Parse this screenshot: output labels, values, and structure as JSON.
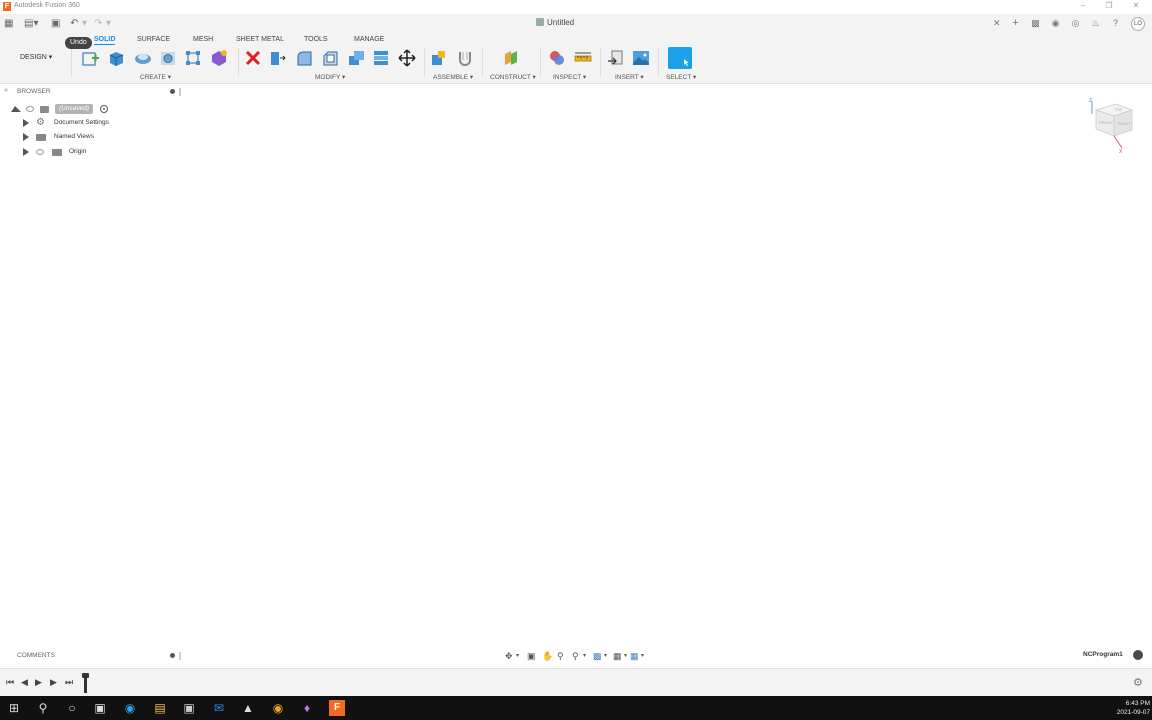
{
  "app": {
    "title": "Autodesk Fusion 360",
    "icon_letter": "F",
    "document_tab": "Untitled",
    "user_initials": "LO"
  },
  "tooltip": {
    "text": "Undo"
  },
  "tabs": [
    {
      "label": "SOLID",
      "active": true
    },
    {
      "label": "SURFACE"
    },
    {
      "label": "MESH"
    },
    {
      "label": "SHEET METAL"
    },
    {
      "label": "TOOLS"
    },
    {
      "label": "MANAGE"
    }
  ],
  "workspace_label": "DESIGN",
  "groups": {
    "create": "CREATE",
    "modify": "MODIFY",
    "assemble": "ASSEMBLE",
    "construct": "CONSTRUCT",
    "inspect": "INSPECT",
    "insert": "INSERT",
    "select": "SELECT"
  },
  "browser": {
    "title": "BROWSER",
    "root": "(Unsaved)",
    "items": [
      {
        "label": "Document Settings"
      },
      {
        "label": "Named Views"
      },
      {
        "label": "Origin"
      }
    ]
  },
  "viewcube": {
    "front": "FRONT",
    "right": "RIGHT",
    "top": "TOP",
    "axis_z": "Z",
    "axis_x": "X"
  },
  "comments": {
    "title": "COMMENTS"
  },
  "status": {
    "nc_program": "NCProgram1"
  },
  "taskbar": {
    "time": "6:43 PM",
    "date": "2021-09-07"
  },
  "colors": {
    "accent": "#1e88e5",
    "select_blue": "#1aa1e8",
    "delete_red": "#e02020",
    "fusion_orange": "#f26b21"
  }
}
